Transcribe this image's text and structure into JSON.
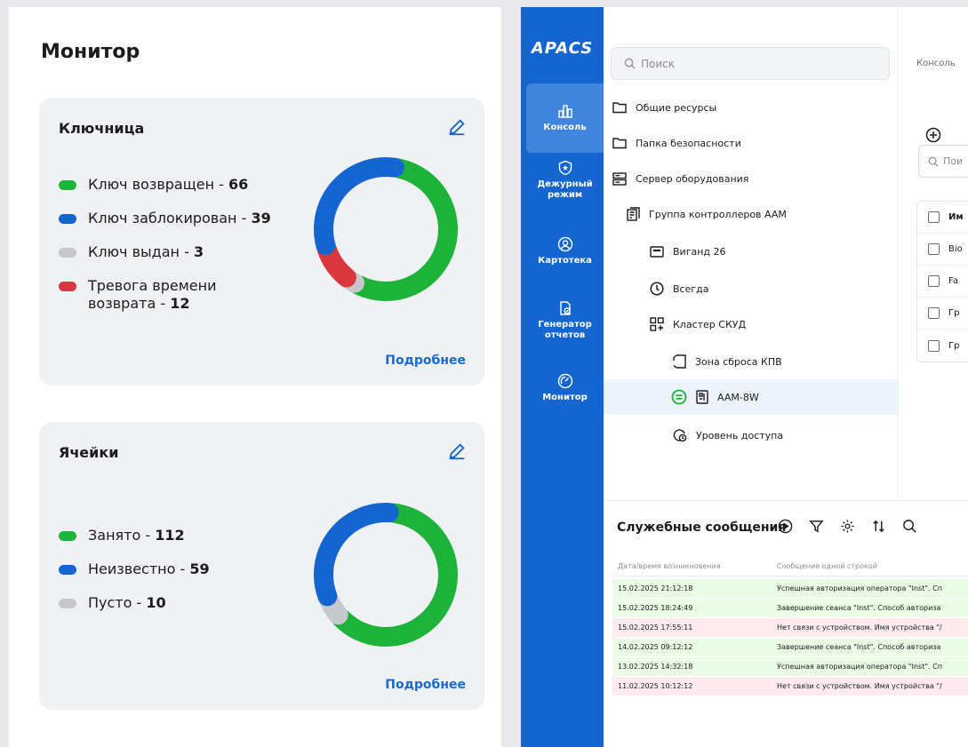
{
  "monitor": {
    "title": "Монитор",
    "cards": [
      {
        "title": "Ключница",
        "more": "Подробнее",
        "legend": [
          {
            "label": "Ключ возвращен - ",
            "value": "66",
            "color": "#1db33a"
          },
          {
            "label": "Ключ заблокирован - ",
            "value": "39",
            "color": "#1565d0"
          },
          {
            "label": "Ключ выдан  - ",
            "value": "3",
            "color": "#c7c8cc"
          },
          {
            "label": "Тревога времени возврата - ",
            "value": "12",
            "color": "#d9363e"
          }
        ]
      },
      {
        "title": "Ячейки",
        "more": "Подробнее",
        "legend": [
          {
            "label": "Занято - ",
            "value": "112",
            "color": "#1db33a"
          },
          {
            "label": "Неизвестно  - ",
            "value": "59",
            "color": "#1565d0"
          },
          {
            "label": "Пусто  - ",
            "value": "10",
            "color": "#c7c8cc"
          }
        ]
      }
    ]
  },
  "sidebar": {
    "brand": "APACS",
    "items": [
      {
        "label": "Консоль",
        "icon": "chart-icon"
      },
      {
        "label": "Дежурный режим",
        "icon": "shield-icon"
      },
      {
        "label": "Картотека",
        "icon": "user-circle-icon"
      },
      {
        "label": "Генератор отчетов",
        "icon": "report-icon"
      },
      {
        "label": "Монитор",
        "icon": "gauge-icon"
      }
    ]
  },
  "tree": {
    "search_placeholder": "Поиск",
    "items": [
      {
        "label": "Общие ресурсы",
        "icon": "folder-icon"
      },
      {
        "label": "Папка безопасности",
        "icon": "folder-icon"
      },
      {
        "label": "Сервер оборудования",
        "icon": "server-icon"
      },
      {
        "label": "Группа контроллеров AAM",
        "icon": "controller-group-icon"
      },
      {
        "label": "Виганд 26",
        "icon": "card-reader-icon"
      },
      {
        "label": "Всегда",
        "icon": "clock-icon"
      },
      {
        "label": "Кластер СКУД",
        "icon": "cluster-icon"
      },
      {
        "label": "Зона сброса КПВ",
        "icon": "zone-icon"
      },
      {
        "label": "AAM-8W",
        "icon": "device-icon"
      },
      {
        "label": "Уровень доступа",
        "icon": "access-level-icon"
      }
    ]
  },
  "content": {
    "breadcrumb": "Консоль",
    "search_placeholder": "Пои",
    "table": {
      "header": "Им",
      "rows": [
        "Bio",
        "Fa",
        "Гр",
        "Гр"
      ]
    }
  },
  "messages": {
    "title": "Служебные сообщения",
    "columns": [
      "Дата/время возникновения",
      "Сообщение одной строкой"
    ],
    "rows": [
      {
        "date": "15.02.2025 21:12:18",
        "text": "Успешная авторизация оператора \"Inst\". Сп",
        "status": "ok"
      },
      {
        "date": "15.02.2025 18:24:49",
        "text": "Завершение сеанса \"Inst\". Способ авториза",
        "status": "ok"
      },
      {
        "date": "15.02.2025 17:55:11",
        "text": "Нет связи с устройством. Имя устройства \"/",
        "status": "err"
      },
      {
        "date": "14.02.2025 09:12:12",
        "text": "Завершение сеанса \"Inst\". Способ авториза",
        "status": "ok"
      },
      {
        "date": "13.02.2025 14:32:18",
        "text": "Успешная авторизация оператора \"Inst\". Сп",
        "status": "ok"
      },
      {
        "date": "11.02.2025 10:12:12",
        "text": "Нет связи с устройством. Имя устройства \"/",
        "status": "err"
      }
    ]
  },
  "colors": {
    "accent": "#1565d0",
    "green": "#1db33a",
    "grey": "#c7c8cc",
    "red": "#d9363e"
  }
}
